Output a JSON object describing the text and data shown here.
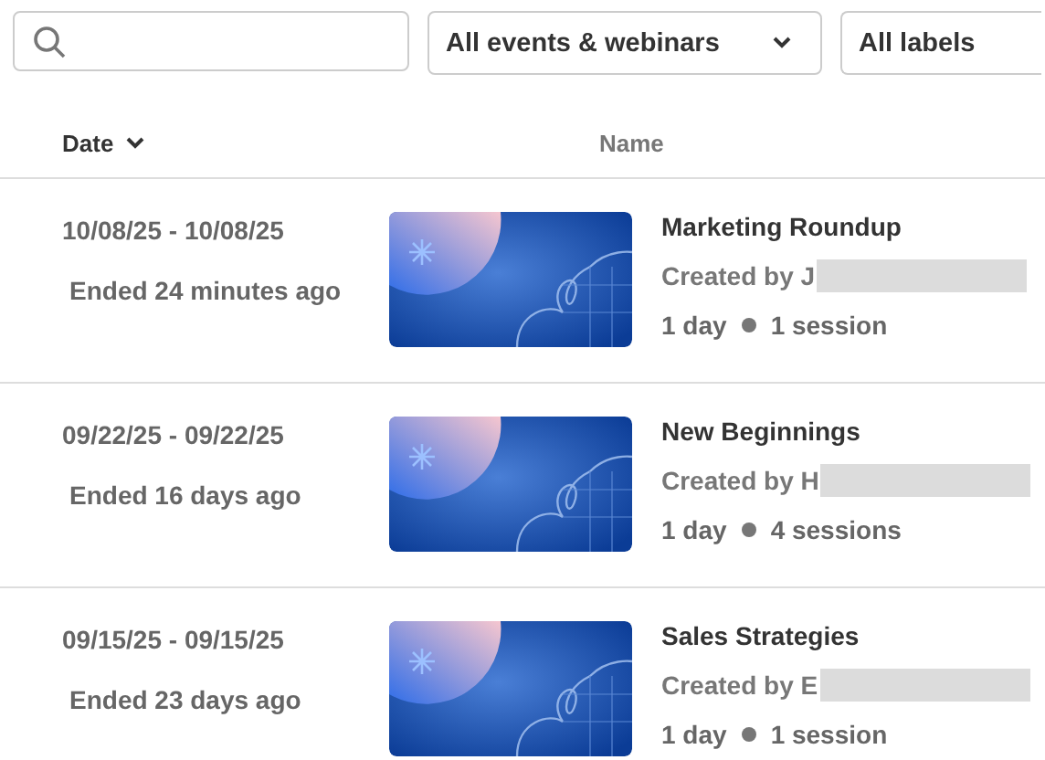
{
  "filters": {
    "dropdowns": [
      {
        "label": "All events & webinars",
        "has_caret": true
      },
      {
        "label": "All labels",
        "has_caret": false
      }
    ]
  },
  "table": {
    "columns": [
      {
        "label": "Date",
        "sorted": true
      },
      {
        "label": "Name",
        "sorted": false
      }
    ],
    "rows": [
      {
        "date_range": "10/08/25 - 10/08/25",
        "status": "Ended 24 minutes ago",
        "name": "Marketing Roundup",
        "created_by": "Created by J",
        "duration": "1 day",
        "sessions": "1 session"
      },
      {
        "date_range": "09/22/25 - 09/22/25",
        "status": "Ended 16 days ago",
        "name": "New Beginnings",
        "created_by": "Created by H",
        "duration": "1 day",
        "sessions": "4 sessions"
      },
      {
        "date_range": "09/15/25 - 09/15/25",
        "status": "Ended 23 days ago",
        "name": "Sales Strategies",
        "created_by": "Created by E",
        "duration": "1 day",
        "sessions": "1 session"
      }
    ]
  }
}
